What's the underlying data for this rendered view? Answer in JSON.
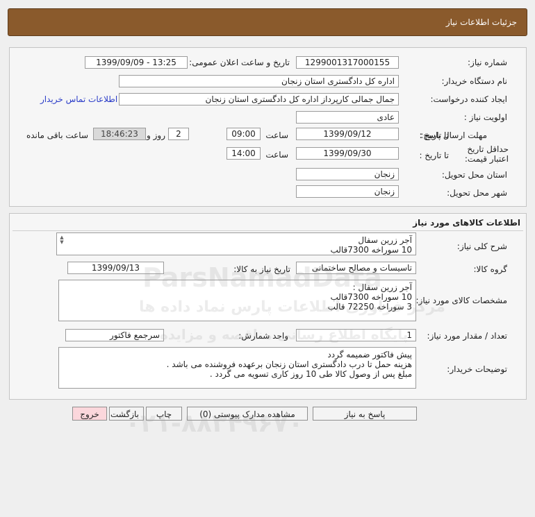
{
  "header": {
    "title": "جزئیات اطلاعات نیاز"
  },
  "info": {
    "need_number_label": "شماره نیاز:",
    "need_number": "1299001317000155",
    "announce_label": "تاریخ و ساعت اعلان عمومی:",
    "announce_value": "1399/09/09 - 13:25",
    "buyer_org_label": "نام دستگاه خریدار:",
    "buyer_org": "اداره کل دادگستری استان زنجان",
    "requester_label": "ایجاد کننده درخواست:",
    "requester": "جمال جمالی کارپرداز اداره کل دادگستری استان زنجان",
    "contact_link": "اطلاعات تماس خریدار",
    "priority_label": "اولویت نیاز :",
    "priority": "عادی",
    "reply_deadline_label": "مهلت ارسال پاسخ:",
    "to_date_label": "تا تاریخ :",
    "reply_date": "1399/09/12",
    "time_label": "ساعت",
    "reply_time": "09:00",
    "days_value": "2",
    "days_label": "روز و",
    "remaining_time": "18:46:23",
    "remaining_label": "ساعت باقی مانده",
    "price_validity_label": "حداقل تاریخ اعتبار قیمت:",
    "price_to_date_label": "تا تاریخ :",
    "price_date": "1399/09/30",
    "price_time_label": "ساعت",
    "price_time": "14:00",
    "province_label": "استان محل تحویل:",
    "province": "زنجان",
    "city_label": "شهر محل تحویل:",
    "city": "زنجان"
  },
  "goods": {
    "section_title": "اطلاعات کالاهای مورد نیاز",
    "desc_label": "شرح کلی نیاز:",
    "desc_lines": [
      "آجر زرین سفال",
      "10  سوراخه 7300قالب"
    ],
    "group_label": "گروه کالا:",
    "group_value": "تاسیسات و مصالح ساختمانی",
    "need_date_label": "تاریخ نیاز به کالا:",
    "need_date": "1399/09/13",
    "spec_label": "مشخصات کالای مورد نیاز:",
    "spec_lines": [
      "آجر زرین سفال :",
      "10  سوراخه 7300قالب",
      "3 سوراخه 72250 قالب"
    ],
    "qty_label": "تعداد / مقدار مورد نیاز:",
    "qty_value": "1",
    "unit_label": "واحد شمارش:",
    "unit_value": "سرجمع فاکتور",
    "buyer_notes_label": "توضیحات خریدار:",
    "notes_lines": [
      "پیش فاکتور ضمیمه گردد",
      "هزینه حمل تا درب دادگستری استان زنجان برعهده فروشنده می باشد .",
      "مبلغ پس از وصول کالا طی 10 روز کاری تسویه می گردد ."
    ]
  },
  "buttons": {
    "reply": "پاسخ به نیاز",
    "attachments": "مشاهده مدارک پیوستی (0)",
    "print": "چاپ",
    "back": "بازگشت",
    "exit": "خروج"
  },
  "watermark": {
    "brand": "ParsNamadData",
    "persian": "مرکز فراوری اطلاعات پارس نماد داده ها",
    "sub": "پایگاه اطلاع رسانی مناقصه و مزایده",
    "phone": "۰۲۱-۸۸۳۴۹۶۷۰"
  },
  "colors": {
    "header_bg": "#8a5a2c",
    "link": "#2a3cc8",
    "exit_bg": "#fbd7dc"
  }
}
